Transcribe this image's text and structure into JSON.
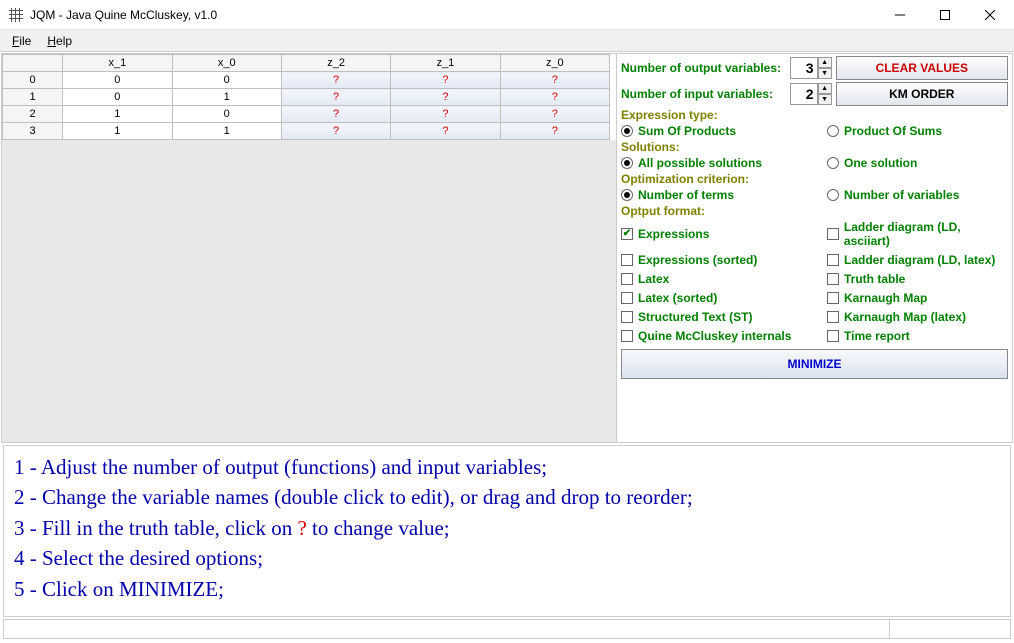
{
  "window": {
    "title": "JQM - Java Quine McCluskey, v1.0"
  },
  "menu": {
    "file": "File",
    "help": "Help"
  },
  "table": {
    "headers": [
      "",
      "x_1",
      "x_0",
      "z_2",
      "z_1",
      "z_0"
    ],
    "rows": [
      {
        "idx": "0",
        "cells": [
          "0",
          "0",
          "?",
          "?",
          "?"
        ]
      },
      {
        "idx": "1",
        "cells": [
          "0",
          "1",
          "?",
          "?",
          "?"
        ]
      },
      {
        "idx": "2",
        "cells": [
          "1",
          "0",
          "?",
          "?",
          "?"
        ]
      },
      {
        "idx": "3",
        "cells": [
          "1",
          "1",
          "?",
          "?",
          "?"
        ]
      }
    ]
  },
  "controls": {
    "output_label": "Number of output variables:",
    "output_value": "3",
    "input_label": "Number  of  input  variables:",
    "input_value": "2",
    "clear": "CLEAR VALUES",
    "km": "KM ORDER"
  },
  "sections": {
    "expr_type": "Expression type:",
    "sop": "Sum Of Products",
    "pos": "Product Of Sums",
    "solutions": "Solutions:",
    "all": "All possible solutions",
    "one": "One solution",
    "opt_crit": "Optimization criterion:",
    "nterms": "Number of terms",
    "nvars": "Number of variables",
    "out_fmt": "Optput format:",
    "minimize": "MINIMIZE"
  },
  "formats": {
    "expressions": "Expressions",
    "ladder_ascii": "Ladder diagram (LD, asciiart)",
    "expr_sorted": "Expressions (sorted)",
    "ladder_latex": "Ladder diagram (LD, latex)",
    "latex": "Latex",
    "truth_table": "Truth table",
    "latex_sorted": "Latex (sorted)",
    "kmap": "Karnaugh Map",
    "st": "Structured Text (ST)",
    "kmap_latex": "Karnaugh Map (latex)",
    "qm_internals": "Quine McCluskey internals",
    "time_report": "Time report"
  },
  "instructions": {
    "l1": "1 - Adjust the number of output (functions) and input variables;",
    "l2": "2 - Change the variable names (double click to edit), or drag and drop to reorder;",
    "l3a": "3 - Fill in the truth table, click on ",
    "l3q": "?",
    "l3b": " to change value;",
    "l4": "4 - Select the desired options;",
    "l5": "5 - Click on MINIMIZE;"
  }
}
